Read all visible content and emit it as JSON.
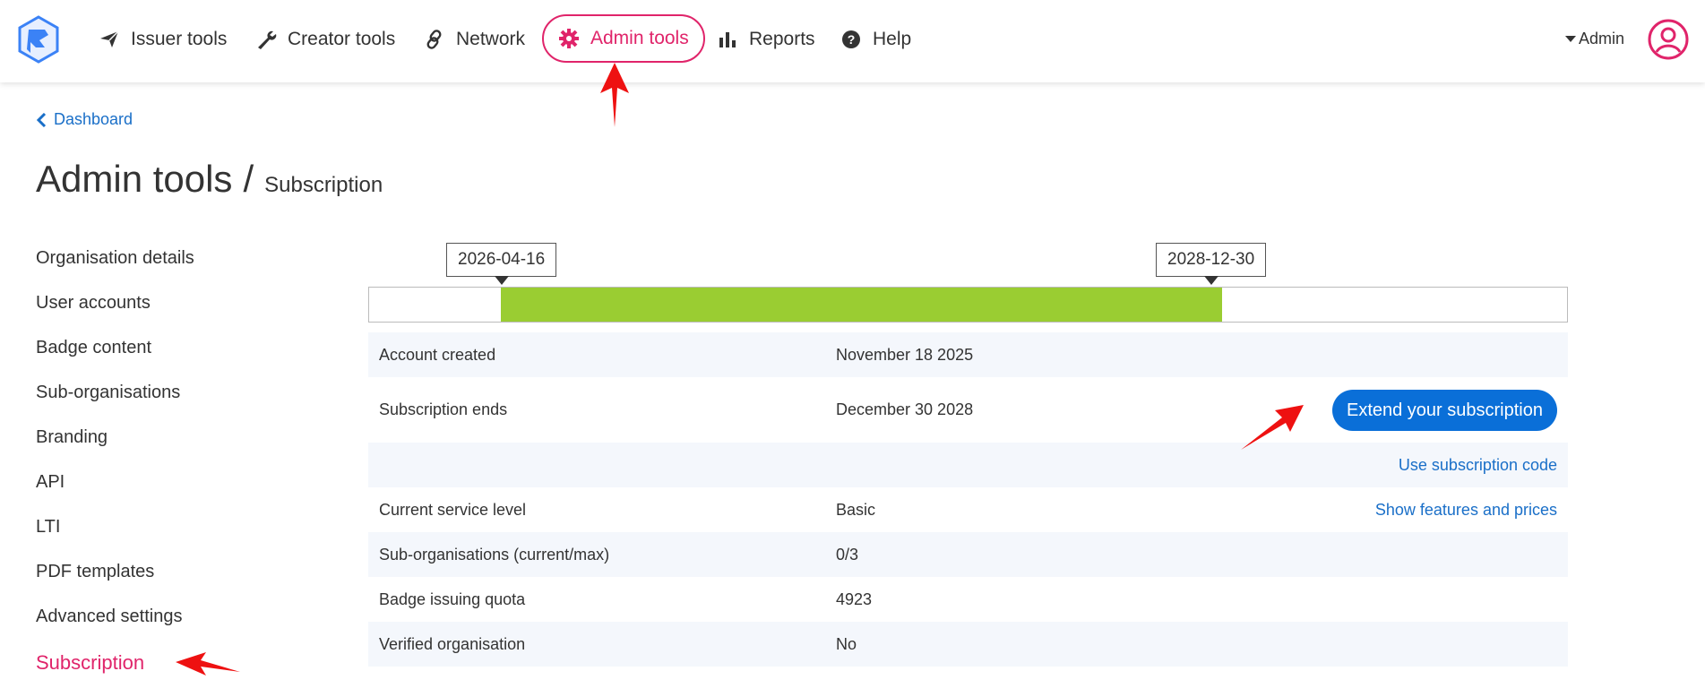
{
  "nav": {
    "items": [
      {
        "label": "Issuer tools",
        "icon": "paper-plane-icon"
      },
      {
        "label": "Creator tools",
        "icon": "wrench-icon"
      },
      {
        "label": "Network",
        "icon": "link-icon"
      },
      {
        "label": "Admin tools",
        "icon": "gear-icon"
      },
      {
        "label": "Reports",
        "icon": "bar-chart-icon"
      },
      {
        "label": "Help",
        "icon": "question-circle-icon"
      }
    ],
    "user": "Admin"
  },
  "breadcrumb": {
    "back": "Dashboard"
  },
  "title": {
    "main": "Admin tools",
    "separator": "/",
    "sub": "Subscription"
  },
  "sidebar": {
    "items": [
      {
        "label": "Organisation details"
      },
      {
        "label": "User accounts"
      },
      {
        "label": "Badge content"
      },
      {
        "label": "Sub-organisations"
      },
      {
        "label": "Branding"
      },
      {
        "label": "API"
      },
      {
        "label": "LTI"
      },
      {
        "label": "PDF templates"
      },
      {
        "label": "Advanced settings"
      },
      {
        "label": "Subscription"
      }
    ]
  },
  "timeline": {
    "start": "2026-04-16",
    "end": "2028-12-30"
  },
  "info": {
    "account_created": {
      "label": "Account created",
      "value": "November 18 2025"
    },
    "subscription_ends": {
      "label": "Subscription ends",
      "value": "December 30 2028"
    },
    "extend_button": "Extend your subscription",
    "use_code": "Use subscription code",
    "service_level": {
      "label": "Current service level",
      "value": "Basic"
    },
    "show_features": "Show features and prices",
    "sub_orgs": {
      "label": "Sub-organisations (current/max)",
      "value": "0/3"
    },
    "quota": {
      "label": "Badge issuing quota",
      "value": "4923"
    },
    "verified": {
      "label": "Verified organisation",
      "value": "No"
    }
  },
  "colors": {
    "accent": "#e0246a",
    "link": "#1a6fc8",
    "button": "#0a6fd8",
    "bar": "#9acd32",
    "annotation": "#ee1111"
  }
}
